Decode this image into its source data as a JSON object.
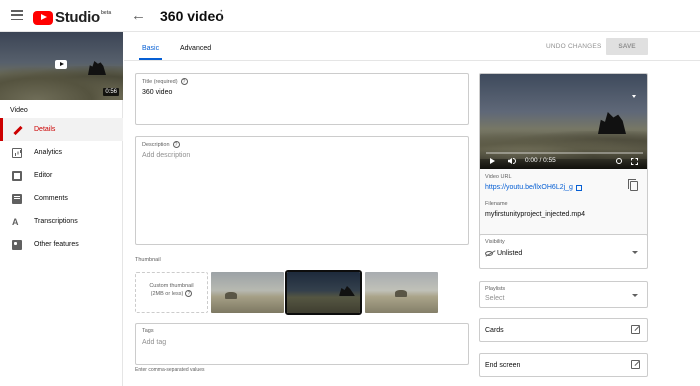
{
  "app": {
    "logo_text": "Studio",
    "logo_badge": "beta",
    "page_title": "360 video"
  },
  "sidebar": {
    "thumbnail_duration": "0:56",
    "section_label": "Video",
    "items": [
      {
        "label": "Details",
        "icon": "pencil-icon",
        "active": true
      },
      {
        "label": "Analytics",
        "icon": "analytics-icon",
        "active": false
      },
      {
        "label": "Editor",
        "icon": "film-icon",
        "active": false
      },
      {
        "label": "Comments",
        "icon": "comment-icon",
        "active": false
      },
      {
        "label": "Transcriptions",
        "icon": "translate-icon",
        "active": false
      },
      {
        "label": "Other features",
        "icon": "other-features-icon",
        "active": false
      }
    ]
  },
  "tabs": {
    "basic": "Basic",
    "advanced": "Advanced"
  },
  "actions": {
    "undo": "UNDO CHANGES",
    "save": "SAVE"
  },
  "form": {
    "title_label": "Title (required)",
    "title_value": "360 video",
    "description_label": "Description",
    "description_placeholder": "Add description",
    "thumbnail_label": "Thumbnail",
    "custom_thumbnail": "Custom thumbnail",
    "custom_thumbnail_note": "(2MB or less)",
    "tags_label": "Tags",
    "tags_placeholder": "Add tag",
    "tags_help": "Enter comma-separated values"
  },
  "video": {
    "time": "0:00 / 0:55",
    "url_label": "Video URL",
    "url": "https://youtu.be/llxOH6L2j_g",
    "filename_label": "Filename",
    "filename": "myfirstunityproject_injected.mp4"
  },
  "side_fields": {
    "visibility_label": "Visibility",
    "visibility_value": "Unlisted",
    "playlists_label": "Playlists",
    "playlists_placeholder": "Select",
    "cards": "Cards",
    "end_screen": "End screen"
  },
  "colors": {
    "brand_red": "#ff0000",
    "active_red": "#cc0000",
    "link_blue": "#065fd4"
  }
}
